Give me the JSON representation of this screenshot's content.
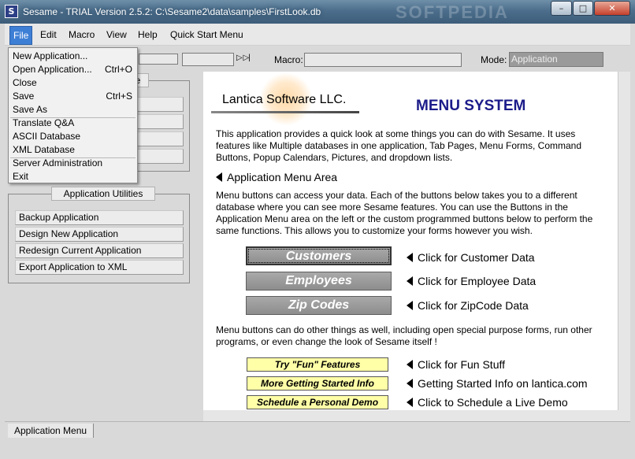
{
  "window": {
    "title": "Sesame - TRIAL Version 2.5.2: C:\\Sesame2\\data\\samples\\FirstLook.db",
    "icon_letter": "S",
    "watermark": "SOFTPEDIA",
    "controls": {
      "minimize": "–",
      "maximize": "□",
      "close": "✕"
    }
  },
  "menubar": {
    "items": [
      "File",
      "Edit",
      "Macro",
      "View",
      "Help",
      "Quick Start Menu"
    ]
  },
  "file_menu": {
    "items": [
      {
        "label": "New Application...",
        "shortcut": ""
      },
      {
        "label": "Open Application...",
        "shortcut": "Ctrl+O"
      },
      {
        "label": "Close",
        "shortcut": ""
      },
      {
        "label": "Save",
        "shortcut": "Ctrl+S"
      },
      {
        "label": "Save As",
        "shortcut": ""
      },
      {
        "label": "Translate Q&A",
        "shortcut": ""
      },
      {
        "label": "ASCII Database",
        "shortcut": ""
      },
      {
        "label": "XML Database",
        "shortcut": ""
      },
      {
        "label": "Server Administration",
        "shortcut": ""
      },
      {
        "label": "Exit",
        "shortcut": ""
      }
    ]
  },
  "toolbar": {
    "nav_glyph": "▷ ▷|",
    "macro_label": "Macro:",
    "macro_value": "",
    "mode_label": "Mode:",
    "mode_value": "Application"
  },
  "left_panel": {
    "top_group_title_fragment": "e",
    "utilities_title": "Application Utilities",
    "utilities": [
      "Backup Application",
      "Design New Application",
      "Redesign Current Application",
      "Export Application to XML"
    ]
  },
  "content": {
    "logo_text": "Lantica Software LLC.",
    "heading": "MENU SYSTEM",
    "intro": "This application provides a quick look at some things you can do with Sesame. It uses features like Multiple databases in one application, Tab Pages, Menu Forms, Command Buttons, Popup Calendars, Pictures, and dropdown lists.",
    "section_title": "Application Menu Area",
    "menu_para": "Menu buttons can access your data. Each of the buttons below takes you to a different database where you can see more Sesame features. You can use the Buttons in the Application Menu area on the left or the custom programmed buttons below to perform the same functions. This allows you to customize your forms however you wish.",
    "data_buttons": [
      {
        "label": "Customers",
        "note": "Click for Customer Data"
      },
      {
        "label": "Employees",
        "note": "Click for Employee Data"
      },
      {
        "label": "Zip Codes",
        "note": "Click for ZipCode Data"
      }
    ],
    "other_para": "Menu buttons can do other things as well, including open special purpose forms, run other programs, or even change the look of Sesame itself !",
    "fun_buttons": [
      {
        "label": "Try \"Fun\" Features",
        "note": "Click for Fun Stuff"
      },
      {
        "label": "More Getting Started Info",
        "note": "Getting Started Info on lantica.com"
      },
      {
        "label": "Schedule a Personal Demo",
        "note": "Click to Schedule a Live Demo"
      }
    ]
  },
  "statusbar": {
    "tab_label": "Application Menu"
  },
  "colors": {
    "menu_highlight": "#3e7fd6",
    "heading": "#1b1b8a",
    "yellow_button": "#ffffa8",
    "gray_button": "#999999"
  }
}
